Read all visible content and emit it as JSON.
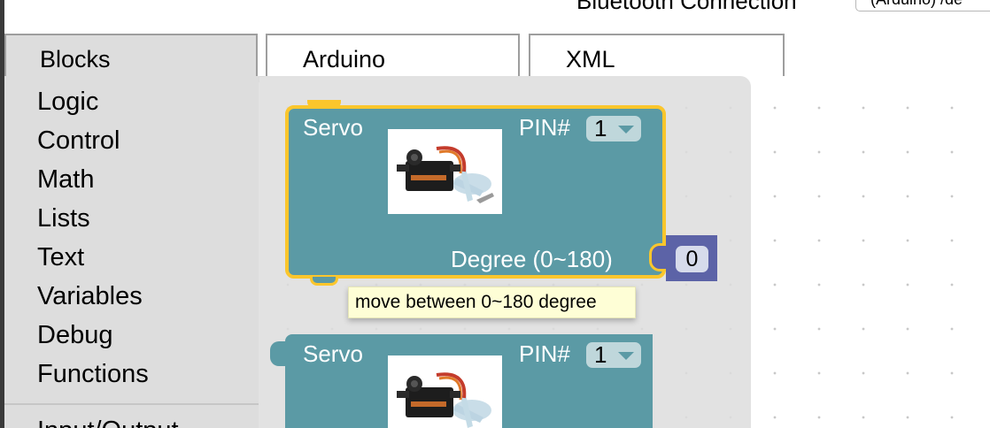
{
  "header": {
    "bluetooth_label": "Bluetooth Connection",
    "bluetooth_select_value": "(Arduino) /de"
  },
  "tabs": [
    {
      "label": "Blocks"
    },
    {
      "label": "Arduino"
    },
    {
      "label": "XML"
    }
  ],
  "toolbox": {
    "categories": [
      "Logic",
      "Control",
      "Math",
      "Lists",
      "Text",
      "Variables",
      "Debug",
      "Functions",
      "Input/Output"
    ]
  },
  "blocks": [
    {
      "title": "Servo",
      "pin_label": "PIN#",
      "pin_value": "1",
      "degree_label": "Degree (0~180)",
      "degree_value": "0",
      "image_icon": "servo-motor-icon"
    },
    {
      "title": "Servo",
      "pin_label": "PIN#",
      "pin_value": "1",
      "image_icon": "servo-motor-icon"
    }
  ],
  "tooltip": {
    "text": "move between 0~180 degree"
  },
  "colors": {
    "servo_block": "#5b9aa5",
    "selection_outline": "#fbc62c",
    "math_block": "#5c63a7",
    "toolbox_bg": "#dddddd",
    "tooltip_bg": "#fefed6"
  }
}
